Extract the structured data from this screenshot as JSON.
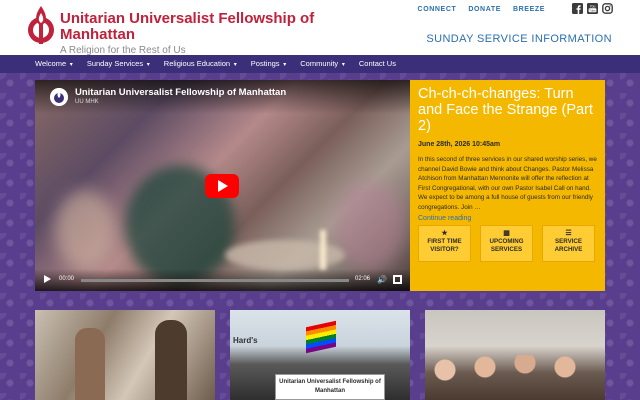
{
  "header": {
    "title": "Unitarian Universalist Fellowship of Manhattan",
    "tagline": "A Religion for the Rest of Us",
    "top_links": [
      "CONNECT",
      "DONATE",
      "BREEZE"
    ],
    "social_icons": [
      "facebook-icon",
      "youtube-icon",
      "instagram-icon"
    ],
    "sunday_link": "SUNDAY SERVICE INFORMATION"
  },
  "nav": {
    "items": [
      {
        "label": "Welcome"
      },
      {
        "label": "Sunday Services"
      },
      {
        "label": "Religious Education"
      },
      {
        "label": "Postings"
      },
      {
        "label": "Community"
      },
      {
        "label": "Contact Us"
      }
    ]
  },
  "video": {
    "title": "Unitarian Universalist Fellowship of Manhattan",
    "channel": "UU MHK",
    "current_time": "00:00",
    "duration": "02:06"
  },
  "featured": {
    "title": "Ch-ch-ch-changes: Turn and Face the Strange (Part 2)",
    "date": "June 28th, 2026 10:45am",
    "body": "In this second of three services in our shared worship series, we channel David Bowie and think about Changes. Pastor Melissa Atchison from Manhattan Mennonite will offer the reflection at First Congregational, with our own Pastor Isabel Call on hand. We expect to be among a full house of guests from our friendly congregations. Join …",
    "more_label": "Continue reading",
    "cta": [
      {
        "icon": "star-icon",
        "glyph": "★",
        "label": "FIRST TIME VISITOR?"
      },
      {
        "icon": "calendar-icon",
        "glyph": "▦",
        "label": "UPCOMING SERVICES"
      },
      {
        "icon": "list-icon",
        "glyph": "☰",
        "label": "SERVICE ARCHIVE"
      }
    ]
  },
  "photos": {
    "sign_text": "Unitarian Universalist Fellowship of Manhattan",
    "store_text": "Hard's"
  },
  "colors": {
    "brand_red": "#c0213b",
    "link_blue": "#2a6fb0",
    "nav_bg": "#3a2f78",
    "panel_yellow": "#f5b800",
    "background_purple": "#5a3e8e"
  }
}
